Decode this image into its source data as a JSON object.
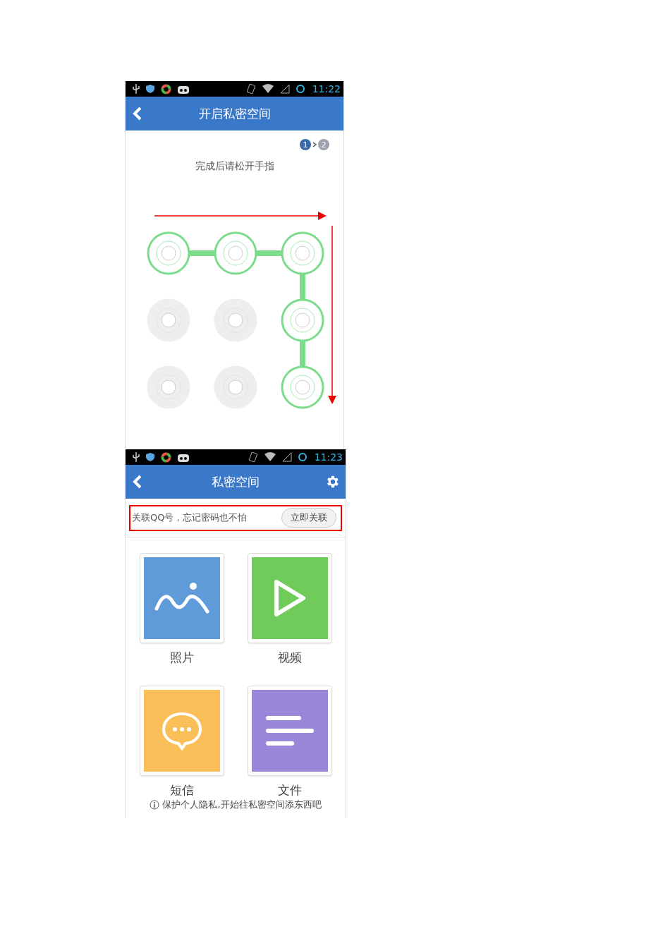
{
  "screens": [
    {
      "status_bar": {
        "time": "11:22"
      },
      "header": {
        "title": "开启私密空间",
        "settings": false
      },
      "steps": [
        {
          "label": "1",
          "selected": true
        },
        {
          "label": "2",
          "selected": false
        }
      ],
      "hint": "完成后请松开手指",
      "pattern": [
        {
          "selected": true
        },
        {
          "selected": true
        },
        {
          "selected": true
        },
        {
          "selected": false
        },
        {
          "selected": false
        },
        {
          "selected": true
        },
        {
          "selected": false
        },
        {
          "selected": false
        },
        {
          "selected": true
        }
      ]
    },
    {
      "status_bar": {
        "time": "11:23"
      },
      "header": {
        "title": "私密空间",
        "settings": true
      },
      "banner": {
        "text": "关联QQ号，忘记密码也不怕",
        "button": "立即关联"
      },
      "tiles": [
        {
          "kind": "photo",
          "label": "照片"
        },
        {
          "kind": "video",
          "label": "视频"
        },
        {
          "kind": "message",
          "label": "短信"
        },
        {
          "kind": "file",
          "label": "文件"
        }
      ],
      "footer": "保护个人隐私,开始往私密空间添东西吧"
    }
  ]
}
